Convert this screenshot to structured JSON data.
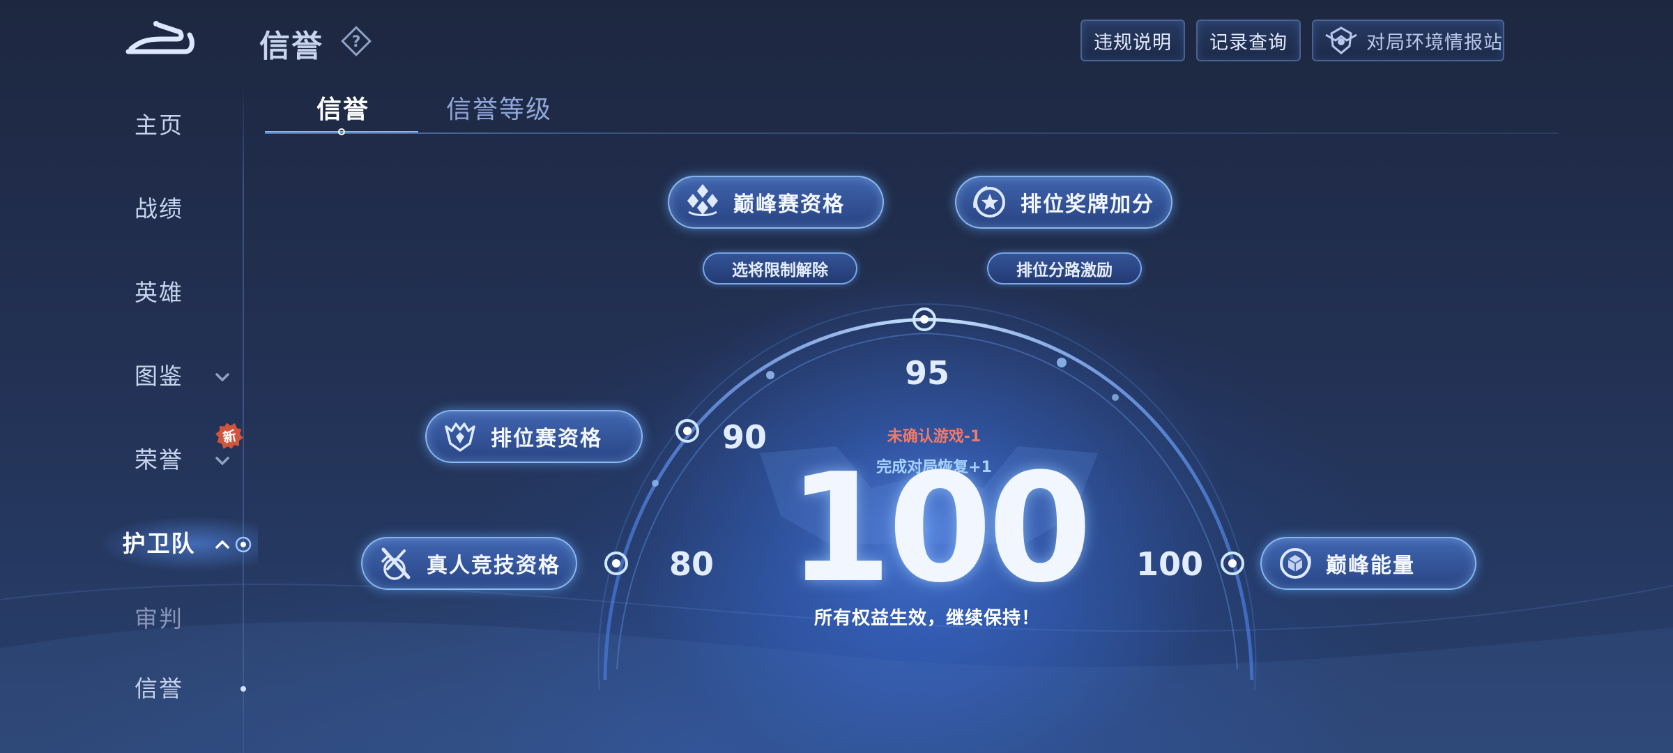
{
  "header": {
    "title": "信誉",
    "buttons": [
      {
        "label": "违规说明"
      },
      {
        "label": "记录查询"
      },
      {
        "label": "对局环境情报站"
      }
    ]
  },
  "sidebar": {
    "items": [
      {
        "label": "主页"
      },
      {
        "label": "战绩"
      },
      {
        "label": "英雄"
      },
      {
        "label": "图鉴"
      },
      {
        "label": "荣誉"
      },
      {
        "label": "护卫队"
      },
      {
        "label": "审判"
      },
      {
        "label": "信誉"
      }
    ],
    "new_badge": "新"
  },
  "tabs": [
    {
      "label": "信誉",
      "active": true
    },
    {
      "label": "信誉等级",
      "active": false
    }
  ],
  "perks": {
    "peak_qualification": "巅峰赛资格",
    "ranked_medal_bonus": "排位奖牌加分",
    "hero_pick_unlock": "选将限制解除",
    "ranked_lane_incentive": "排位分路激励",
    "ranked_qualification": "排位赛资格",
    "real_person_qualification": "真人竞技资格",
    "peak_energy": "巅峰能量"
  },
  "gauge": {
    "ticks": [
      "80",
      "90",
      "95",
      "100"
    ],
    "score": "100",
    "note_penalty": "未确认游戏-1",
    "note_recover": "完成对局恢复+1",
    "status": "所有权益生效，继续保持！"
  },
  "colors": {
    "accent": "#7fb8ff",
    "penalty": "#f07a6a",
    "recover": "#a8d4ff",
    "badge": "#d0553c"
  }
}
